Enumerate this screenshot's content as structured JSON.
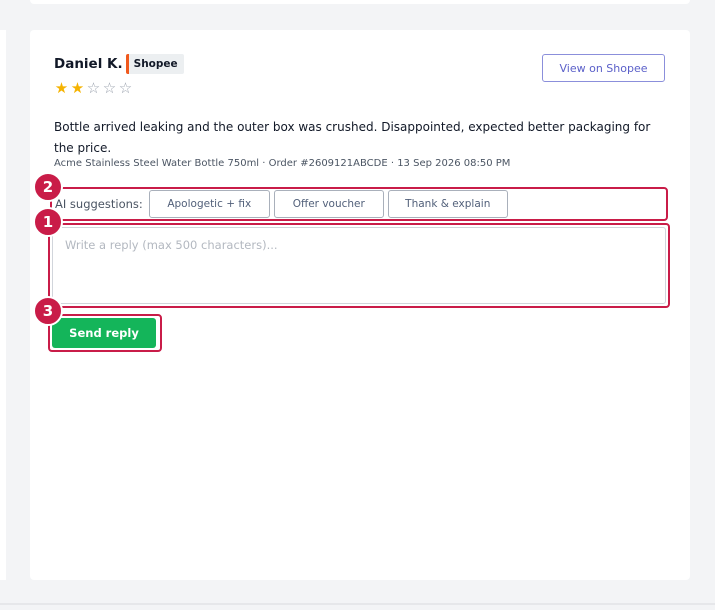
{
  "review": {
    "reviewer_name": "Daniel K.",
    "platform": "Shopee",
    "rating": 2,
    "rating_max": 5,
    "view_button_label": "View on Shopee",
    "text": "Bottle arrived leaking and the outer box was crushed. Disappointed, expected better packaging for the price.",
    "meta": "Acme Stainless Steel Water Bottle 750ml · Order #2609121ABCDE · 13 Sep 2026 08:50 PM"
  },
  "ai_suggestions": {
    "label": "AI suggestions:",
    "chips": [
      "Apologetic + fix",
      "Offer voucher",
      "Thank & explain"
    ]
  },
  "reply": {
    "placeholder": "Write a reply (max 500 characters)...",
    "value": "",
    "send_label": "Send reply"
  },
  "markers": {
    "ai_row": "2",
    "reply_box": "1",
    "send": "3"
  },
  "colors": {
    "platform_accent": "#f0591d",
    "star_filled": "#f5b301",
    "highlight": "#c91c48",
    "send_button": "#14b55a",
    "view_button": "#5b60c9"
  }
}
